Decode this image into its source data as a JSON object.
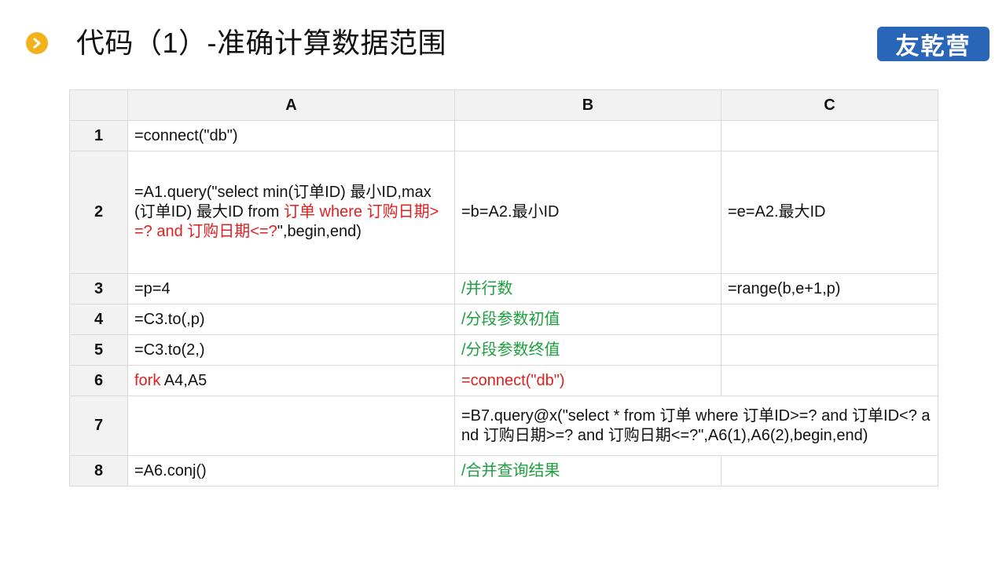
{
  "slide": {
    "title": "代码（1）-准确计算数据范围",
    "logo_text": "友乾营",
    "bullet_icon": "chevron-right-icon",
    "colors": {
      "bullet": "#f3b21b",
      "logo_bg": "#2a66b8",
      "keyword_red": "#e02020",
      "comment_green": "#1f9e3f",
      "header_bg": "#f2f2f2"
    }
  },
  "grid": {
    "corner": "",
    "columns": [
      "A",
      "B",
      "C"
    ],
    "rows": [
      {
        "num": "1",
        "a": [
          {
            "t": "=connect(\"db\")",
            "c": ""
          }
        ],
        "b": [],
        "c": []
      },
      {
        "num": "2",
        "a": [
          {
            "t": "=A1.query(\"select min(订单ID) 最小ID,max(订单ID) 最大ID from ",
            "c": ""
          },
          {
            "t": "订单 where 订购日期>=? and 订购日期<=?",
            "c": "red"
          },
          {
            "t": "\",begin,end)",
            "c": ""
          }
        ],
        "b": [
          {
            "t": "=b=A2.最小ID",
            "c": ""
          }
        ],
        "c": [
          {
            "t": "=e=A2.最大ID",
            "c": ""
          }
        ]
      },
      {
        "num": "3",
        "a": [
          {
            "t": "=p=4",
            "c": ""
          }
        ],
        "b": [
          {
            "t": "/并行数",
            "c": "green"
          }
        ],
        "c": [
          {
            "t": " =range(b,e+1,p)",
            "c": ""
          }
        ]
      },
      {
        "num": "4",
        "a": [
          {
            "t": "=C3.to(,p)",
            "c": ""
          }
        ],
        "b": [
          {
            "t": "/分段参数初值",
            "c": "green"
          }
        ],
        "c": []
      },
      {
        "num": "5",
        "a": [
          {
            "t": "=C3.to(2,)",
            "c": ""
          }
        ],
        "b": [
          {
            "t": "/分段参数终值",
            "c": "green"
          }
        ],
        "c": []
      },
      {
        "num": "6",
        "a": [
          {
            "t": "fork",
            "c": "red"
          },
          {
            "t": " A4,A5",
            "c": ""
          }
        ],
        "b": [
          {
            "t": "=connect(\"db\")",
            "c": "red"
          }
        ],
        "c": []
      },
      {
        "num": "7",
        "a": [],
        "bc": [
          {
            "t": "=B7.query@x(\"select * from 订单 where 订单ID>=? and 订单ID<? and 订购日期>=? and 订购日期<=?\",A6(1),A6(2),begin,end)",
            "c": ""
          }
        ]
      },
      {
        "num": "8",
        "a": [
          {
            "t": "=A6.conj()",
            "c": ""
          }
        ],
        "b": [
          {
            "t": "/合并查询结果",
            "c": "green"
          }
        ],
        "c": []
      }
    ]
  }
}
